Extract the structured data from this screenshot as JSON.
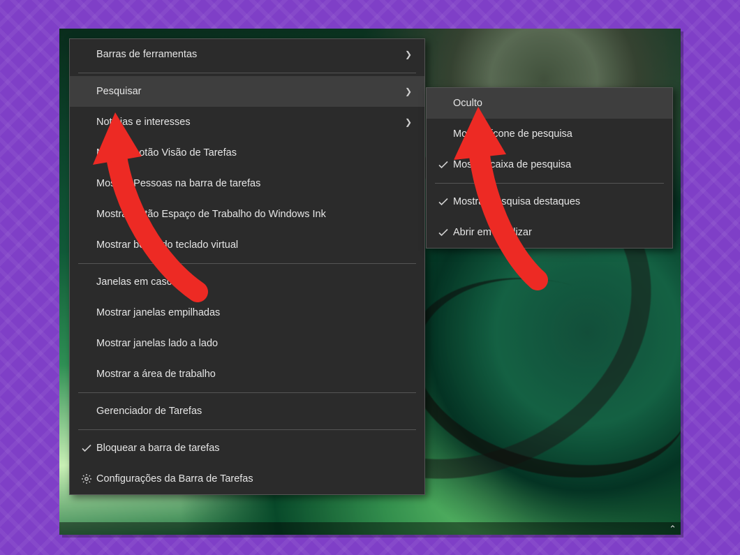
{
  "colors": {
    "frame_bg": "#7f3fc7",
    "menu_bg": "#2b2b2b",
    "menu_fg": "#e6e6e6",
    "menu_hover": "#3e3e3e",
    "annotation": "#ed2a24"
  },
  "main_menu": {
    "toolbars": "Barras de ferramentas",
    "search": "Pesquisar",
    "news_interests": "Notícias e interesses",
    "show_taskview": "Mostrar botão Visão de Tarefas",
    "show_people": "Mostrar Pessoas na barra de tarefas",
    "show_ink": "Mostrar botão Espaço de Trabalho do Windows Ink",
    "show_touchkb": "Mostrar botão do teclado virtual",
    "cascade": "Janelas em cascata",
    "stacked": "Mostrar janelas empilhadas",
    "sidebyside": "Mostrar janelas lado a lado",
    "show_desktop": "Mostrar a área de trabalho",
    "task_manager": "Gerenciador de Tarefas",
    "lock_taskbar": "Bloquear a barra de tarefas",
    "taskbar_settings": "Configurações da Barra de Tarefas"
  },
  "sub_menu": {
    "hidden": "Oculto",
    "show_search_icon": "Mostrar ícone de pesquisa",
    "show_search_box": "Mostrar caixa de pesquisa",
    "show_search_highlights": "Mostrar pesquisa destaques",
    "open_on_hover": "Abrir em focalizar"
  }
}
